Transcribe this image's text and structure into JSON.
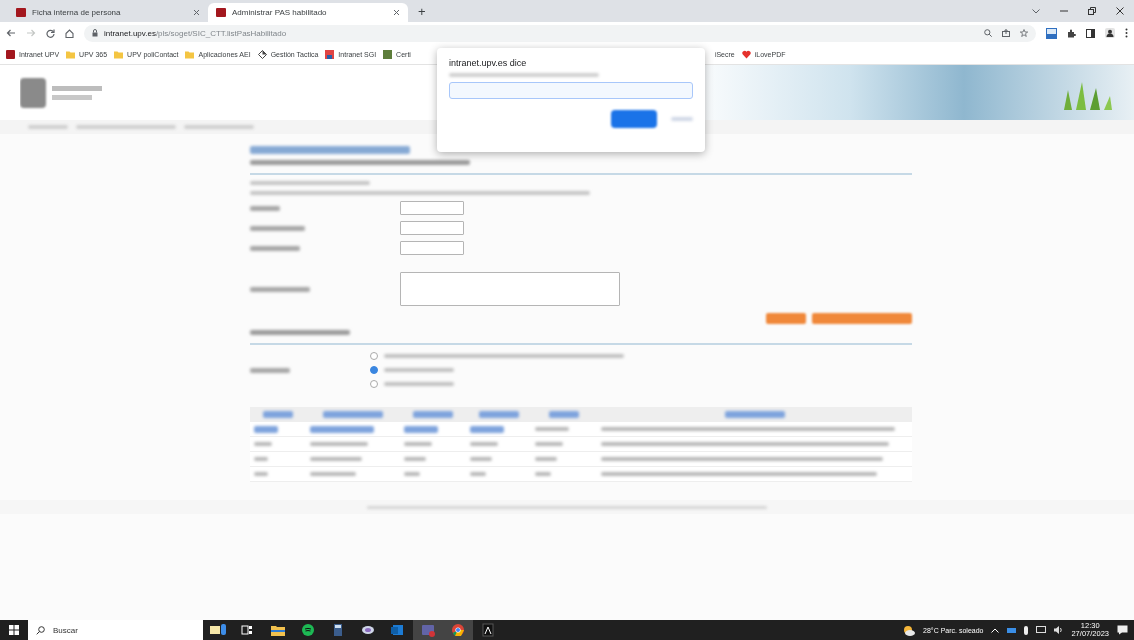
{
  "browser": {
    "tabs": [
      {
        "title": "Ficha interna de persona",
        "selected": false
      },
      {
        "title": "Administrar PAS habilitado",
        "selected": true
      }
    ],
    "new_tab": "+",
    "address": {
      "domain": "intranet.upv.es",
      "path": "/pls/soget/SIC_CTT.listPasHabilitado"
    },
    "bookmarks": [
      {
        "label": "Intranet UPV",
        "kind": "upv"
      },
      {
        "label": "UPV 365",
        "kind": "folder"
      },
      {
        "label": "UPV poliContact",
        "kind": "folder"
      },
      {
        "label": "Aplicaciones AEI",
        "kind": "folder"
      },
      {
        "label": "Gestión Tactica",
        "kind": "diamond"
      },
      {
        "label": "Intranet SGI",
        "kind": "sgi"
      },
      {
        "label": "Certi",
        "kind": "green"
      }
    ],
    "bookmarks_right": [
      {
        "label": "iSecre",
        "kind": "none"
      },
      {
        "label": "iLovePDF",
        "kind": "heart"
      }
    ]
  },
  "page": {
    "radio_options": [
      {
        "selected": false
      },
      {
        "selected": true
      },
      {
        "selected": false
      }
    ]
  },
  "dialog": {
    "title": "intranet.upv.es dice"
  },
  "taskbar": {
    "search_placeholder": "Buscar",
    "weather": "28°C Parc. soleado",
    "time": "12:30",
    "date": "27/07/2023"
  }
}
